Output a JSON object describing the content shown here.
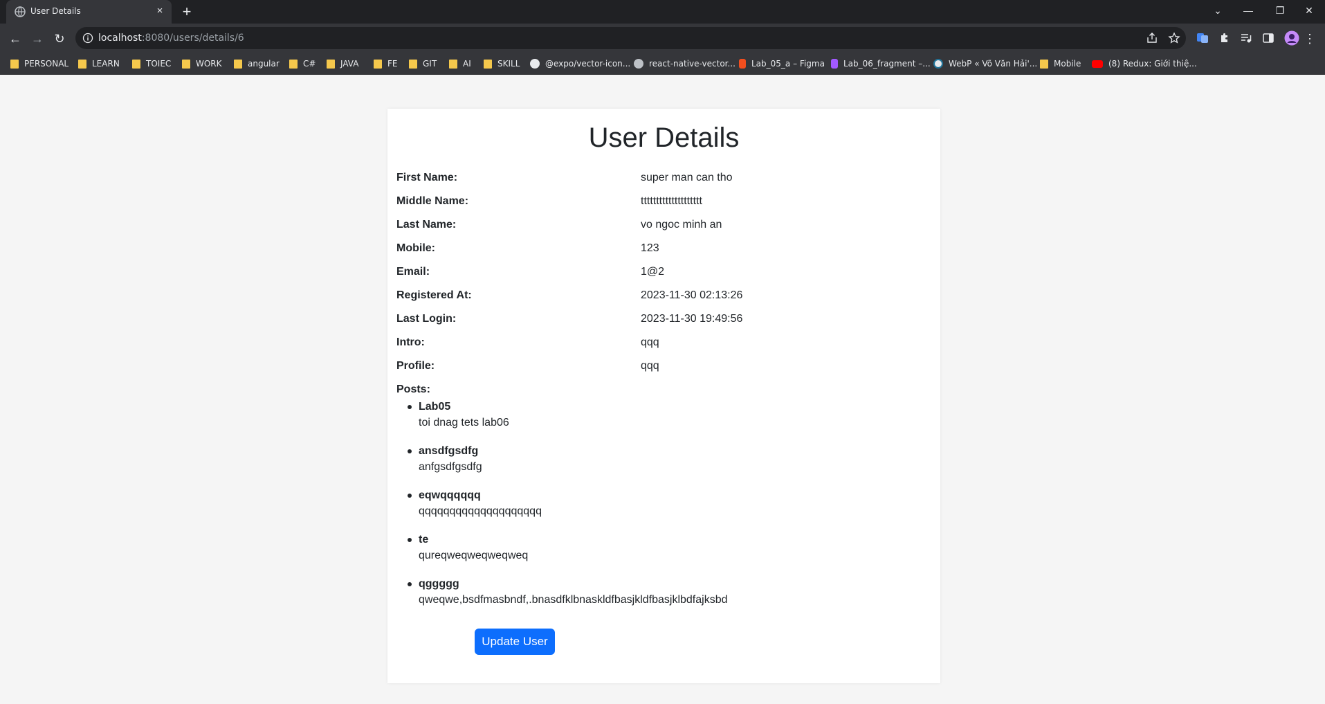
{
  "browser": {
    "tab_title": "User Details",
    "tab_close": "×",
    "new_tab": "+",
    "url_host": "localhost",
    "url_path": ":8080/users/details/6",
    "window_controls": {
      "dropdown": "⌄",
      "minimize": "—",
      "restore": "❐",
      "close": "✕"
    },
    "nav": {
      "back": "←",
      "forward": "→",
      "reload": "↻",
      "menu": "⋮"
    },
    "bookmarks": [
      {
        "label": "PERSONAL",
        "icon": "folder-icon"
      },
      {
        "label": "LEARN",
        "icon": "folder-icon"
      },
      {
        "label": "TOIEC",
        "icon": "folder-icon"
      },
      {
        "label": "WORK",
        "icon": "folder-icon"
      },
      {
        "label": "angular",
        "icon": "folder-icon"
      },
      {
        "label": "C#",
        "icon": "folder-icon"
      },
      {
        "label": "JAVA",
        "icon": "folder-icon"
      },
      {
        "label": "FE",
        "icon": "folder-icon"
      },
      {
        "label": "GIT",
        "icon": "folder-icon"
      },
      {
        "label": "AI",
        "icon": "folder-icon"
      },
      {
        "label": "SKILL",
        "icon": "folder-icon"
      },
      {
        "label": "@expo/vector-icon...",
        "icon": "expo-icon"
      },
      {
        "label": "react-native-vector...",
        "icon": "globe-icon"
      },
      {
        "label": "Lab_05_a – Figma",
        "icon": "figma-icon"
      },
      {
        "label": "Lab_06_fragment –...",
        "icon": "figma-icon"
      },
      {
        "label": "WebP « Võ Văn Hải'...",
        "icon": "wordpress-icon"
      },
      {
        "label": "Mobile",
        "icon": "folder-icon"
      },
      {
        "label": "(8) Redux: Giới thiệ...",
        "icon": "youtube-icon"
      }
    ]
  },
  "page": {
    "title": "User Details",
    "fields": [
      {
        "label": "First Name:",
        "value": "super man can tho"
      },
      {
        "label": "Middle Name:",
        "value": "tttttttttttttttttttt"
      },
      {
        "label": "Last Name:",
        "value": "vo ngoc minh an"
      },
      {
        "label": "Mobile:",
        "value": "123"
      },
      {
        "label": "Email:",
        "value": "1@2"
      },
      {
        "label": "Registered At:",
        "value": "2023-11-30 02:13:26"
      },
      {
        "label": "Last Login:",
        "value": "2023-11-30 19:49:56"
      },
      {
        "label": "Intro:",
        "value": "qqq"
      },
      {
        "label": "Profile:",
        "value": "qqq"
      }
    ],
    "posts_label": "Posts:",
    "posts": [
      {
        "title": "Lab05",
        "content": "toi dnag tets lab06"
      },
      {
        "title": "ansdfgsdfg",
        "content": "anfgsdfgsdfg"
      },
      {
        "title": "eqwqqqqqq",
        "content": "qqqqqqqqqqqqqqqqqqqq"
      },
      {
        "title": "te",
        "content": "qureqweqweqweqweq"
      },
      {
        "title": "qggggg",
        "content": "qweqwe,bsdfmasbndf,.bnasdfklbnaskldfbasjkldfbasjklbdfajksbd"
      }
    ],
    "update_button": "Update User"
  },
  "colors": {
    "primary_button": "#0d6efd",
    "chrome_dark": "#202124",
    "chrome_toolbar": "#35363a",
    "page_bg": "#f5f5f5"
  }
}
